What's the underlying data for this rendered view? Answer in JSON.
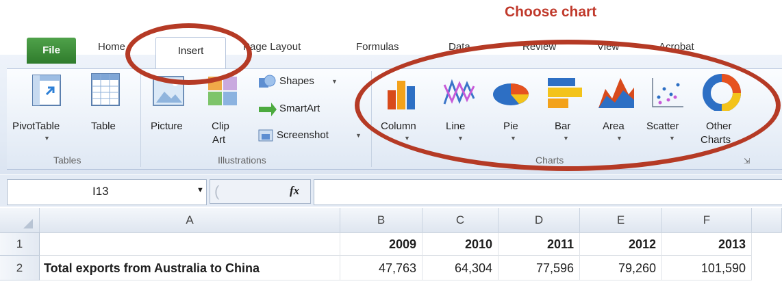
{
  "annotation": {
    "text": "Choose chart"
  },
  "tabs": [
    "File",
    "Home",
    "Insert",
    "Page Layout",
    "Formulas",
    "Data",
    "Review",
    "View",
    "Acrobat"
  ],
  "tables_group": {
    "label": "Tables",
    "pivot": "PivotTable",
    "table": "Table"
  },
  "illustrations_group": {
    "label": "Illustrations",
    "picture": "Picture",
    "clip_art_1": "Clip",
    "clip_art_2": "Art",
    "shapes": "Shapes",
    "smartart": "SmartArt",
    "screenshot": "Screenshot"
  },
  "charts_group": {
    "label": "Charts",
    "buttons": [
      "Column",
      "Line",
      "Pie",
      "Bar",
      "Area",
      "Scatter",
      "Other"
    ],
    "other_line2": "Charts"
  },
  "formula_bar": {
    "name_box": "I13",
    "fx": "fx"
  },
  "sheet": {
    "columns": [
      "A",
      "B",
      "C",
      "D",
      "E",
      "F"
    ],
    "rows": [
      "1",
      "2"
    ],
    "header_row": [
      "",
      "2009",
      "2010",
      "2011",
      "2012",
      "2013"
    ],
    "data_row": [
      "Total exports from Australia to China",
      "47,763",
      "64,304",
      "77,596",
      "79,260",
      "101,590"
    ]
  },
  "colors": {
    "annotation": "#c0392b",
    "ring": "#b53a25",
    "file_tab": "#3a8a36"
  }
}
